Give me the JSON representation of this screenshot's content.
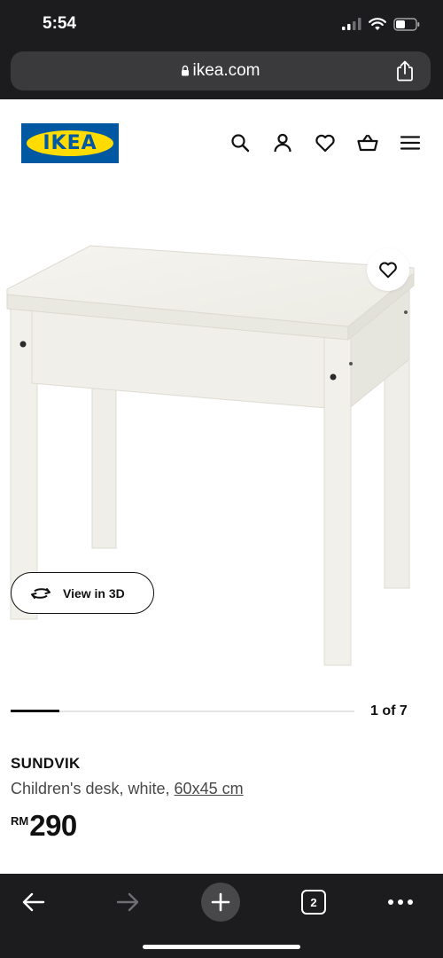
{
  "status_bar": {
    "time": "5:54"
  },
  "browser": {
    "url": "ikea.com"
  },
  "header": {
    "logo_text": "IKEA"
  },
  "gallery": {
    "view_3d_label": "View in 3D",
    "current_page": 1,
    "total_pages": 7,
    "page_counter": "1 of 7"
  },
  "product": {
    "name": "SUNDVIK",
    "description": "Children's desk, white,",
    "dimensions": "60x45 cm",
    "currency": "RM",
    "price": "290"
  },
  "toolbar": {
    "tab_count": "2"
  },
  "colors": {
    "ikea_blue": "#0058a3",
    "ikea_yellow": "#ffdb00",
    "chrome_dark": "#1c1c1e"
  }
}
